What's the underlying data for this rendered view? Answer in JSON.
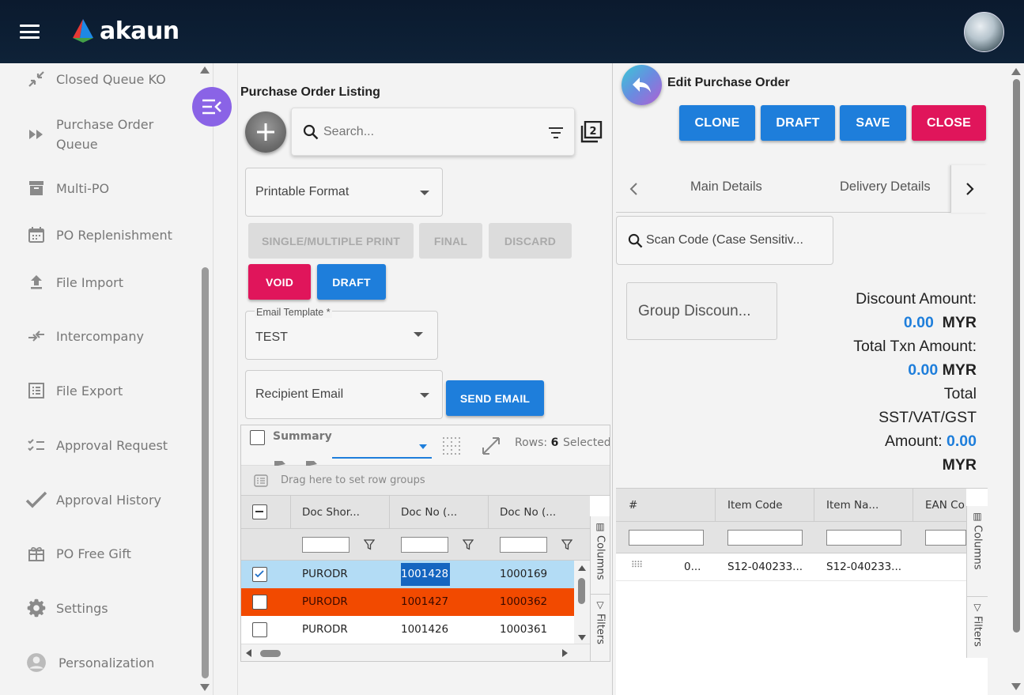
{
  "app": {
    "brand": "akaun"
  },
  "sidebar": {
    "items": [
      {
        "label": "Closed Queue KO",
        "icon": "collapse-arrows-icon"
      },
      {
        "label": "Purchase Order Queue",
        "icon": "fast-forward-icon"
      },
      {
        "label": "Multi-PO",
        "icon": "archive-box-icon"
      },
      {
        "label": "PO Replenishment",
        "icon": "calendar-icon"
      },
      {
        "label": "File Import",
        "icon": "upload-icon"
      },
      {
        "label": "Intercompany",
        "icon": "compare-arrows-icon"
      },
      {
        "label": "File Export",
        "icon": "list-box-icon"
      },
      {
        "label": "Approval Request",
        "icon": "checklist-icon"
      },
      {
        "label": "Approval History",
        "icon": "checkmark-icon"
      },
      {
        "label": "PO Free Gift",
        "icon": "gift-icon"
      },
      {
        "label": "Settings",
        "icon": "gear-icon"
      },
      {
        "label": "Personalization",
        "icon": "user-icon"
      }
    ]
  },
  "listing": {
    "title": "Purchase Order Listing",
    "search_placeholder": "Search...",
    "printable_format": "Printable Format",
    "buttons": {
      "single_multiple_print": "SINGLE/MULTIPLE PRINT",
      "final": "FINAL",
      "discard": "DISCARD",
      "void": "VOID",
      "draft": "DRAFT",
      "send_email": "SEND EMAIL"
    },
    "email_template_label": "Email Template *",
    "email_template_value": "TEST",
    "recipient_email": "Recipient Email",
    "grid": {
      "summary_label": "Summary",
      "rows_label": "Rows:",
      "rows_count": "6",
      "selected_label": "Selected:",
      "drag_hint": "Drag here to set row groups",
      "columns": [
        "Doc Shor...",
        "Doc No (...",
        "Doc No (..."
      ],
      "rows": [
        {
          "c1": "PURODR",
          "c2": "1001428",
          "c3": "1000169",
          "checked": true
        },
        {
          "c1": "PURODR",
          "c2": "1001427",
          "c3": "1000362",
          "checked": false
        },
        {
          "c1": "PURODR",
          "c2": "1001426",
          "c3": "1000361",
          "checked": false
        }
      ],
      "side_columns": "Columns",
      "side_filters": "Filters"
    }
  },
  "edit": {
    "title": "Edit Purchase Order",
    "buttons": {
      "clone": "CLONE",
      "draft": "DRAFT",
      "save": "SAVE",
      "close": "CLOSE"
    },
    "tabs": [
      "Main Details",
      "Delivery Details"
    ],
    "scan_placeholder": "Scan Code (Case Sensitiv...",
    "group_discount": "Group Discoun...",
    "summary": {
      "discount_label": "Discount Amount:",
      "discount_value": "0.00",
      "currency": "MYR",
      "txn_label": "Total Txn Amount:",
      "txn_value": "0.00",
      "tax_label_1": "Total",
      "tax_label_2": "SST/VAT/GST",
      "tax_label_3": "Amount:",
      "tax_value": "0.00"
    },
    "grid": {
      "columns": [
        "#",
        "Item Code",
        "Item Na...",
        "EAN Co"
      ],
      "row": {
        "num": "0...",
        "code": "S12-040233...",
        "name": "S12-040233..."
      },
      "side_columns": "Columns",
      "side_filters": "Filters"
    }
  },
  "colors": {
    "header_bg": "#0b1a2e",
    "primary_blue": "#1e7edb",
    "danger_pink": "#e0155b",
    "selected_row": "#b3dcf5",
    "highlight_row": "#f24a00",
    "fab_purple": "#8a63e6"
  }
}
